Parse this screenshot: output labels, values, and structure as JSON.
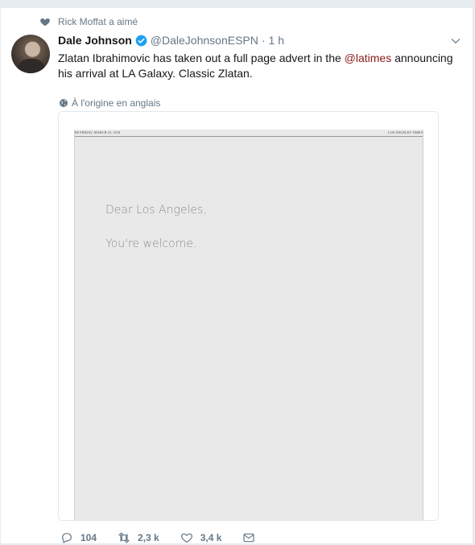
{
  "context": {
    "label": "Rick Moffat a aimé"
  },
  "tweet": {
    "name": "Dale Johnson",
    "handle": "@DaleJohnsonESPN",
    "separator": "·",
    "time": "1 h",
    "text_part1": "Zlatan Ibrahimovic has taken out a full page advert in the ",
    "mention": "@latimes",
    "text_part2": " announcing his arrival at LA Galaxy. Classic Zlatan.",
    "translate_label": "À l'origine en anglais"
  },
  "media": {
    "masthead_left": "B8   FRIDAY, MARCH 23, 2018",
    "masthead_right": "LOS ANGELES TIMES",
    "line1": "Dear Los Angeles,",
    "line2": "You're welcome."
  },
  "actions": {
    "replies": "104",
    "retweets": "2,3 k",
    "likes": "3,4 k"
  },
  "colors": {
    "mention": "#8b1a1a",
    "verified": "#1da1f2",
    "muted": "#657786"
  }
}
